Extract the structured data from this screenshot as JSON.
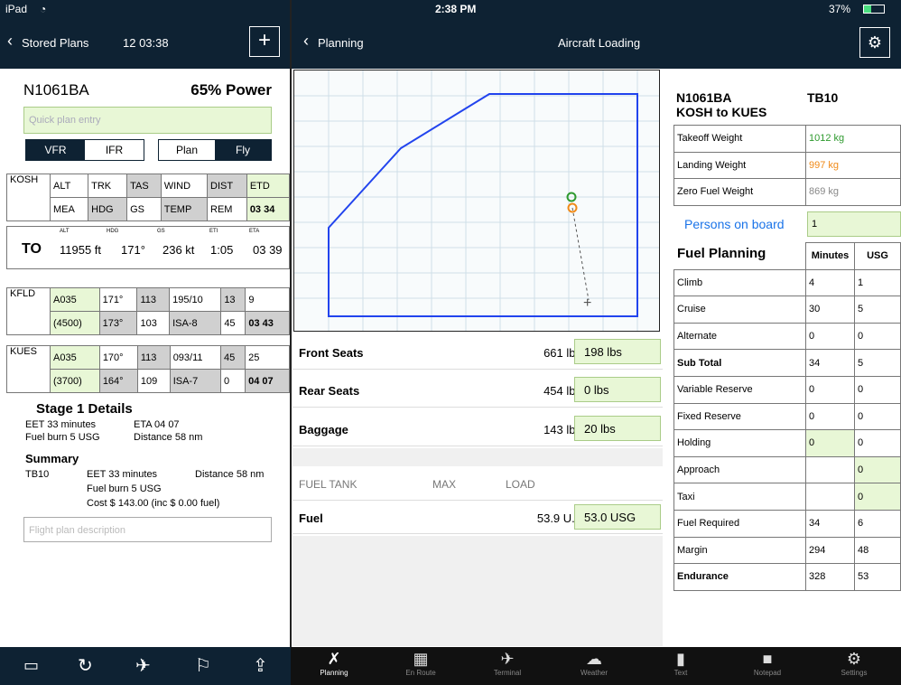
{
  "status": {
    "device": "iPad",
    "wifi": "wifi-icon",
    "time": "2:38 PM",
    "battery": "37%"
  },
  "left_nav": {
    "back": "Stored Plans",
    "time": "12 03:38",
    "add": "+"
  },
  "right_nav": {
    "back": "Planning",
    "title": "Aircraft Loading"
  },
  "left": {
    "tail": "N1061BA",
    "power": "65% Power",
    "quick_placeholder": "Quick plan entry",
    "seg1": [
      "VFR",
      "IFR"
    ],
    "seg2": [
      "Plan",
      "Fly"
    ],
    "departure": {
      "code": "KOSH",
      "row1": [
        "ALT",
        "TRK",
        "TAS",
        "WIND",
        "DIST",
        "ETD"
      ],
      "row2": [
        "MEA",
        "HDG",
        "GS",
        "TEMP",
        "REM",
        "03 34"
      ]
    },
    "to": {
      "label": "TO",
      "headers": [
        "ALT",
        "HDG",
        "GS",
        "ETI",
        "ETA"
      ],
      "values": [
        "11955 ft",
        "171°",
        "236 kt",
        "1:05",
        "03 39"
      ]
    },
    "waypoints": [
      {
        "code": "KFLD",
        "row1": [
          "A035",
          "171°",
          "113",
          "195/10",
          "13",
          "9"
        ],
        "row2": [
          "(4500)",
          "173°",
          "103",
          "ISA-8",
          "45",
          "03 43"
        ]
      },
      {
        "code": "KUES",
        "row1": [
          "A035",
          "170°",
          "113",
          "093/11",
          "45",
          "25"
        ],
        "row2": [
          "(3700)",
          "164°",
          "109",
          "ISA-7",
          "0",
          "04 07"
        ]
      }
    ],
    "stage_title": "Stage 1 Details",
    "stage_eet": "EET 33 minutes",
    "stage_eta": "ETA 04 07",
    "stage_fuel": "Fuel burn 5 USG",
    "stage_dist": "Distance 58 nm",
    "summary_title": "Summary",
    "summary_ac": "TB10",
    "summary_eet": "EET 33 minutes",
    "summary_dist": "Distance 58 nm",
    "summary_fuel": "Fuel burn 5 USG",
    "summary_cost": "Cost $ 143.00 (inc $ 0.00 fuel)",
    "desc_placeholder": "Flight plan description"
  },
  "loading": [
    {
      "label": "Front Seats",
      "max": "661 lbs",
      "load": "198 lbs"
    },
    {
      "label": "Rear Seats",
      "max": "454 lbs",
      "load": "0 lbs"
    },
    {
      "label": "Baggage",
      "max": "143 lbs",
      "load": "20 lbs"
    }
  ],
  "fuel_headers": [
    "FUEL TANK",
    "MAX",
    "LOAD"
  ],
  "fuel": {
    "label": "Fuel",
    "max": "53.9 U...",
    "load": "53.0 USG"
  },
  "right": {
    "tail": "N1061BA",
    "type": "TB10",
    "route": "KOSH to KUES",
    "weights": [
      [
        "Takeoff Weight",
        "1012 kg"
      ],
      [
        "Landing Weight",
        "997 kg"
      ],
      [
        "Zero Fuel Weight",
        "869 kg"
      ]
    ],
    "persons_label": "Persons on board",
    "persons_value": "1",
    "fuel_title": "Fuel Planning",
    "fuel_cols": [
      "Minutes",
      "USG"
    ],
    "fuel_rows": [
      [
        "Climb",
        "4",
        "1"
      ],
      [
        "Cruise",
        "30",
        "5"
      ],
      [
        "Alternate",
        "0",
        "0"
      ],
      [
        "Sub Total",
        "34",
        "5"
      ],
      [
        "Variable Reserve",
        "0",
        "0"
      ],
      [
        "Fixed Reserve",
        "0",
        "0"
      ],
      [
        "Holding",
        "0",
        "0"
      ],
      [
        "Approach",
        "",
        "0"
      ],
      [
        "Taxi",
        "",
        "0"
      ],
      [
        "Fuel Required",
        "34",
        "6"
      ],
      [
        "Margin",
        "294",
        "48"
      ],
      [
        "Endurance",
        "328",
        "53"
      ]
    ],
    "colors": {
      "takeoff": "#2f9a2f",
      "landing": "#f08a18",
      "zerofuel": "#888888",
      "link": "#1a73e8"
    }
  },
  "tabs": [
    "Planning",
    "En Route",
    "Terminal",
    "Weather",
    "Text",
    "Notepad",
    "Settings"
  ]
}
